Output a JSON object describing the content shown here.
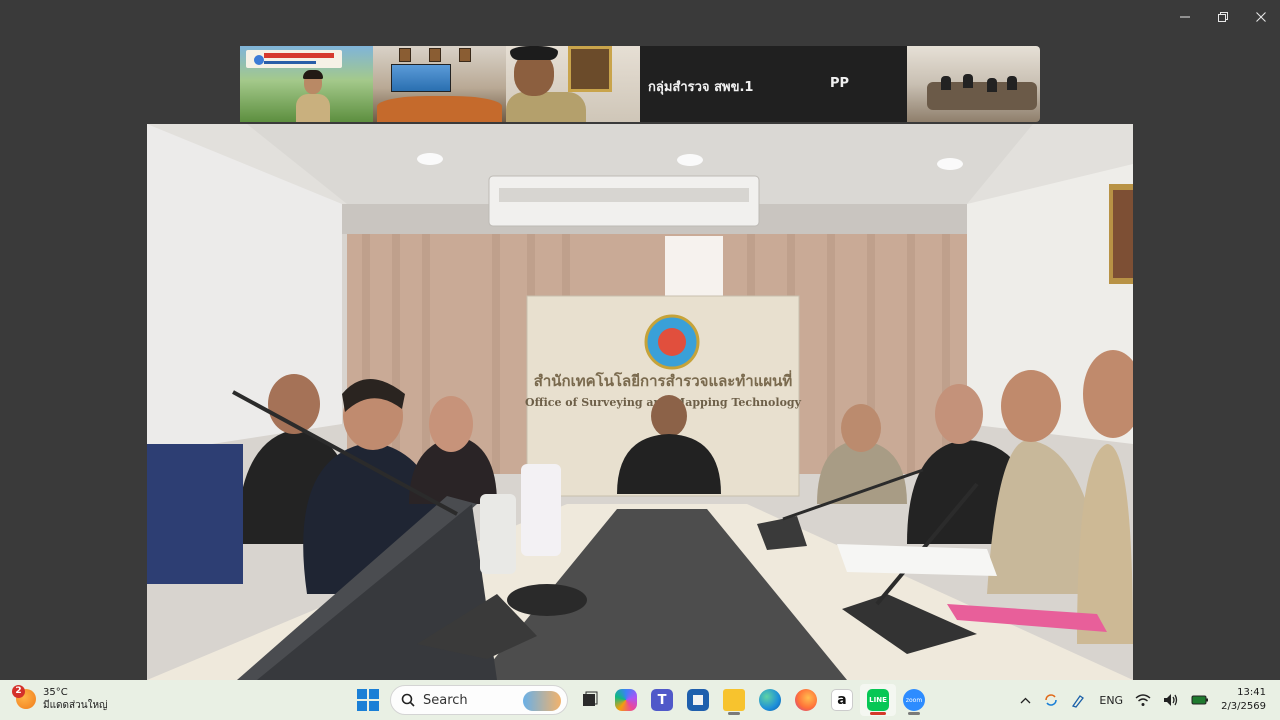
{
  "window": {
    "minimize_icon": "minimize-icon",
    "restore_icon": "restore-icon",
    "close_icon": "close-icon"
  },
  "thumbnails": [
    {
      "label": ""
    },
    {
      "label": ""
    },
    {
      "label": ""
    },
    {
      "name_left": "กลุ่มสำรวจ สพข.1",
      "name_right": "PP"
    },
    {
      "label": ""
    }
  ],
  "main_video": {
    "sign_th": "สำนักเทคโนโลยีการสำรวจและทำแผนที่",
    "sign_en": "Office of Surveying and Mapping Technology"
  },
  "taskbar": {
    "weather": {
      "badge": "2",
      "temp": "35°C",
      "condition": "มีแดดส่วนใหญ่"
    },
    "search_label": "Search",
    "apps": [
      "file-explorer-icon",
      "copilot-icon",
      "teams-icon",
      "store-icon",
      "folder-icon",
      "edge-icon",
      "firefox-icon",
      "amazon-icon",
      "line-icon",
      "zoom-icon"
    ],
    "tray": {
      "language": "ENG",
      "time": "13:41",
      "date": "2/3/2569"
    },
    "colors": {
      "accent": "#1a7fd6",
      "active": "#d43a2a",
      "line_green": "#06c755",
      "zoom_blue": "#2d8cff"
    }
  }
}
